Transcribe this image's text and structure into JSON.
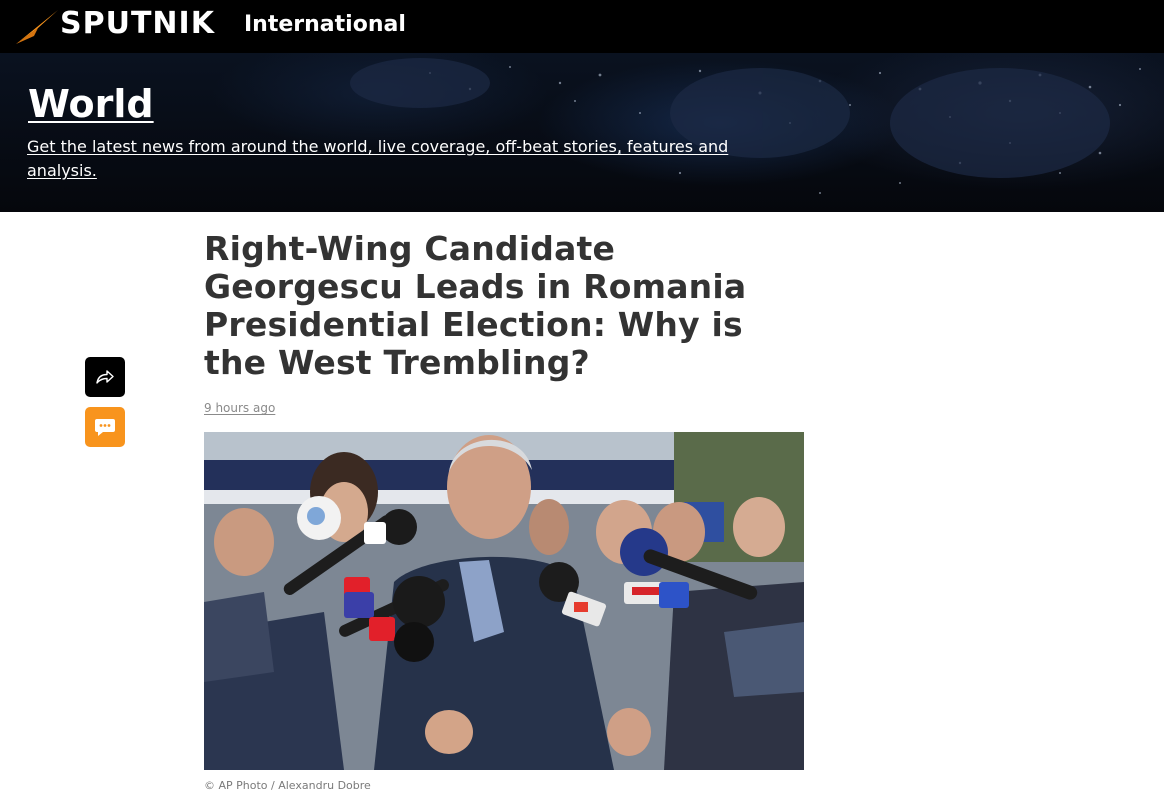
{
  "header": {
    "logo_text": "SPUTNIK",
    "edition": "International",
    "logo_icon": "sputnik-logo-icon",
    "brand_color": "#f8941d",
    "background": "#000000"
  },
  "section": {
    "title": "World",
    "description": "Get the latest news from around the world, live coverage, off-beat stories, features and analysis."
  },
  "actions": {
    "share_icon": "share-arrow-icon",
    "comment_icon": "comment-bubble-icon",
    "comment_color": "#f8941d"
  },
  "article": {
    "headline": "Right-Wing Candidate Georgescu Leads in Romania Presidential Election: Why is the West Trembling?",
    "timestamp": "9 hours ago",
    "photo_credit": "© AP Photo / Alexandru Dobre"
  }
}
